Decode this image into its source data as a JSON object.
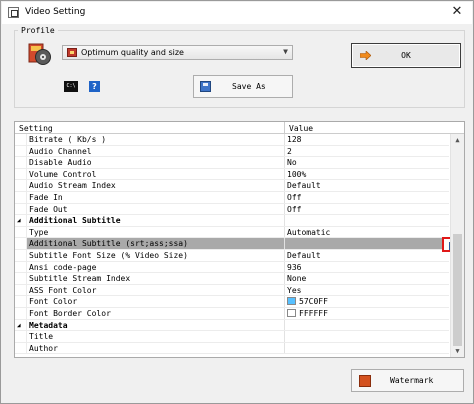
{
  "window": {
    "title": "Video Setting",
    "close_glyph": "✕"
  },
  "profile": {
    "group_label": "Profile",
    "selected": "Optimum quality and size",
    "ok_label": "OK",
    "save_as_label": "Save As",
    "help_glyph": "?"
  },
  "grid": {
    "header_setting": "Setting",
    "header_value": "Value",
    "rows": [
      {
        "name": "Bitrate ( Kb/s )",
        "value": "128"
      },
      {
        "name": "Audio Channel",
        "value": "2"
      },
      {
        "name": "Disable Audio",
        "value": "No"
      },
      {
        "name": "Volume Control",
        "value": "100%"
      },
      {
        "name": "Audio Stream Index",
        "value": "Default"
      },
      {
        "name": "Fade In",
        "value": "Off"
      },
      {
        "name": "Fade Out",
        "value": "Off"
      },
      {
        "name": "Additional Subtitle",
        "value": "",
        "category": true
      },
      {
        "name": "Type",
        "value": "Automatic"
      },
      {
        "name": "Additional Subtitle (srt;ass;ssa)",
        "value": "",
        "selected": true
      },
      {
        "name": "Subtitle Font Size (% Video Size)",
        "value": "Default"
      },
      {
        "name": "Ansi code-page",
        "value": "936"
      },
      {
        "name": "Subtitle Stream Index",
        "value": "None"
      },
      {
        "name": "ASS Font Color",
        "value": "Yes"
      },
      {
        "name": "Font Color",
        "value": "57C0FF",
        "color": "#57c0ff"
      },
      {
        "name": "Font Border Color",
        "value": "FFFFFF",
        "color": "#ffffff"
      },
      {
        "name": "Metadata",
        "value": "",
        "category": true
      },
      {
        "name": "Title",
        "value": ""
      },
      {
        "name": "Author",
        "value": ""
      }
    ]
  },
  "watermark_label": "Watermark",
  "colors": {
    "highlight": "#e01818",
    "selected_row": "#a9a9a9"
  }
}
